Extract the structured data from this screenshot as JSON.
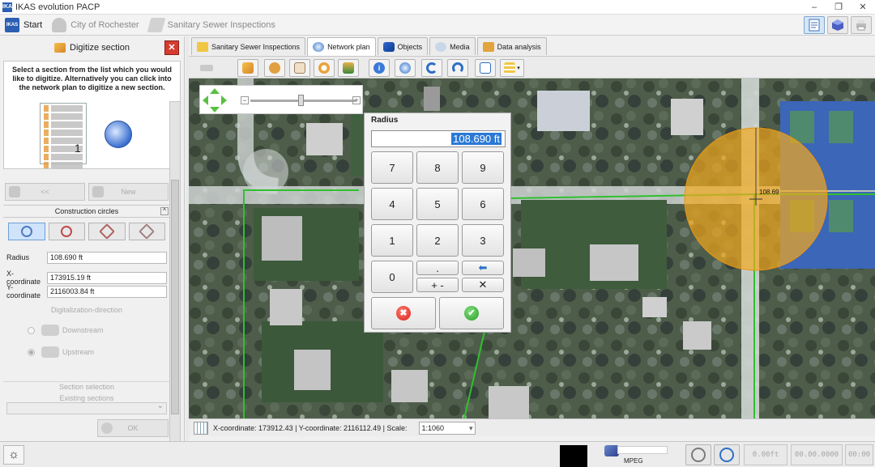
{
  "window": {
    "title": "IKAS evolution  PACP",
    "app_icon": "IKAS"
  },
  "breadcrumb": {
    "start": "Start",
    "city": "City of Rochester",
    "sewer": "Sanitary Sewer Inspections"
  },
  "left_panel": {
    "header": "Digitize section",
    "instruction": "Select a section from the list which you would like to digitize. Alternatively you can click into the network plan to digitize a new section.",
    "illustration_number": "1",
    "prev_label": "<<",
    "new_label": "New",
    "construction_circles_title": "Construction circles",
    "radius_label": "Radius",
    "radius_value": "108.690 ft",
    "x_label": "X-coordinate",
    "x_value": "173915.19 ft",
    "y_label": "Y-coordinate",
    "y_value": "2116003.84 ft",
    "direction_title": "Digitalization-direction",
    "downstream": "Downstream",
    "upstream": "Upstream",
    "section_selection": "Section selection",
    "existing_sections": "Existing sections",
    "ok_label": "OK"
  },
  "tabs": [
    {
      "label": "Sanitary Sewer Inspections",
      "icon": "folder-icon"
    },
    {
      "label": "Network plan",
      "icon": "network-icon",
      "active": true
    },
    {
      "label": "Objects",
      "icon": "objects-icon"
    },
    {
      "label": "Media",
      "icon": "media-icon"
    },
    {
      "label": "Data analysis",
      "icon": "data-analysis-icon"
    }
  ],
  "map": {
    "circle_label": "108.69"
  },
  "dialog": {
    "title": "Radius",
    "value": "108.690 ft",
    "keys": [
      "7",
      "8",
      "9",
      "4",
      "5",
      "6",
      "1",
      "2",
      "3",
      "0",
      ".",
      "+ -",
      "⬅",
      "✕"
    ],
    "cancel_symbol": "✖",
    "confirm_symbol": "✔"
  },
  "status": {
    "coords": "X-coordinate: 173912.43 | Y-coordinate: 2116112.49 | Scale:",
    "scale": "1:1060"
  },
  "bottom": {
    "settings_symbol": "☼",
    "mpeg": "MPEG",
    "distance": "0.00ft",
    "timecode": "00.00.0000",
    "extra": "00:00"
  },
  "colors": {
    "pipe": "#2fc02f",
    "circle": "#f2a81c",
    "accent": "#2b79d6"
  }
}
